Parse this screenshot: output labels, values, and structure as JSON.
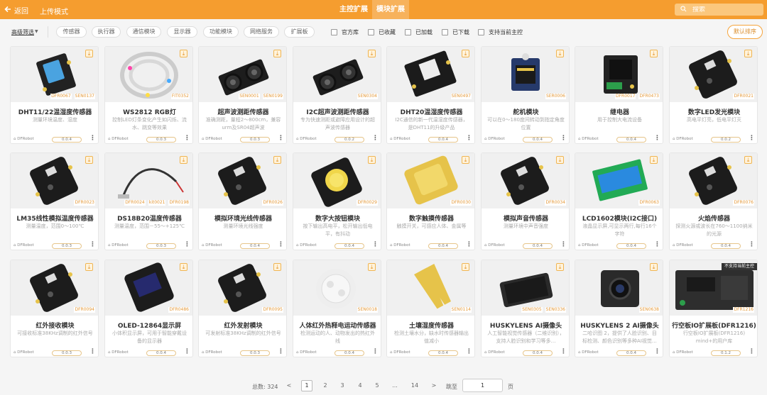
{
  "header": {
    "back_label": "返回",
    "mode_label": "上传模式",
    "tabs": [
      {
        "label": "主控扩展"
      },
      {
        "label": "模块扩展"
      }
    ],
    "search_placeholder": "搜索",
    "colors": {
      "accent": "#f59d2f"
    }
  },
  "filters": {
    "advanced_label": "高级筛选",
    "chips": [
      "传感器",
      "执行器",
      "通信模块",
      "显示器",
      "功能模块",
      "网络服务",
      "扩展板"
    ],
    "checks": [
      "官方库",
      "已收藏",
      "已加载",
      "已下载",
      "支持当前主控"
    ],
    "sort_label": "默认排序"
  },
  "cards": [
    {
      "title": "DHT11/22温湿度传感器",
      "desc": "测量环境温度、湿度",
      "codes": [
        "DFR0067",
        "SEN0137"
      ],
      "brand": "DFRobot",
      "ver": "0.0.4",
      "img": "blue-sensor"
    },
    {
      "title": "WS2812 RGB灯",
      "desc": "控制LED灯条变化产生如闪烁、流水、跳变等效果",
      "codes": [
        "FIT0352"
      ],
      "brand": "DFRobot",
      "ver": "0.0.3",
      "img": "led-strip"
    },
    {
      "title": "超声波测距传感器",
      "desc": "准确测距，量程2～800cm，兼容urm及SR04超声波",
      "codes": [
        "SEN0001",
        "SEN0199"
      ],
      "brand": "DFRobot",
      "ver": "0.0.3",
      "img": "ultrasonic"
    },
    {
      "title": "I2C超声波测距传感器",
      "desc": "专为快速测距或避障应用设计的超声波传感器",
      "codes": [
        "SEN0304"
      ],
      "brand": "DFRobot",
      "ver": "0.0.2",
      "img": "ultrasonic"
    },
    {
      "title": "DHT20温湿度传感器",
      "desc": "I2C通信的新一代温湿度传感器，是DHT11的升级产品",
      "codes": [
        "SEN0497"
      ],
      "brand": "DFRobot",
      "ver": "0.0.4",
      "img": "dht20"
    },
    {
      "title": "舵机模块",
      "desc": "可以在0～180度间转动到指定角度位置",
      "codes": [
        "SER0006"
      ],
      "brand": "DFRobot",
      "ver": "0.0.4",
      "img": "servo"
    },
    {
      "title": "继电器",
      "desc": "用于控制大电流设备",
      "codes": [
        "DFR0017",
        "DFR0473"
      ],
      "brand": "DFRobot",
      "ver": "0.0.4",
      "img": "relay"
    },
    {
      "title": "数字LED发光模块",
      "desc": "高电平灯亮，低电平灯灭",
      "codes": [
        "DFR0021"
      ],
      "brand": "DFRobot",
      "ver": "0.0.2",
      "img": "dark-board"
    },
    {
      "title": "LM35线性模拟温度传感器",
      "desc": "测量温度，范围0～100℃",
      "codes": [
        "DFR0023"
      ],
      "brand": "DFRobot",
      "ver": "0.0.3",
      "img": "dark-board"
    },
    {
      "title": "DS18B20温度传感器",
      "desc": "测量温度，范围－55～+125℃",
      "codes": [
        "DFR0024",
        "kit0021",
        "DFR0198"
      ],
      "brand": "DFRobot",
      "ver": "0.0.3",
      "img": "probe"
    },
    {
      "title": "模拟环境光线传感器",
      "desc": "测量环境光线强度",
      "codes": [
        "DFR0026"
      ],
      "brand": "DFRobot",
      "ver": "0.0.4",
      "img": "dark-board"
    },
    {
      "title": "数字大按钮模块",
      "desc": "按下输出高电平，松开输出低电平，有抖动",
      "codes": [
        "DFR0029"
      ],
      "brand": "DFRobot",
      "ver": "0.0.4",
      "img": "button"
    },
    {
      "title": "数字触摸传感器",
      "desc": "触摸开关，可感应人体、金属等",
      "codes": [
        "DFR0030"
      ],
      "brand": "DFRobot",
      "ver": "0.0.4",
      "img": "touch"
    },
    {
      "title": "模拟声音传感器",
      "desc": "测量环境中声音强度",
      "codes": [
        "DFR0034"
      ],
      "brand": "DFRobot",
      "ver": "0.0.4",
      "img": "dark-board"
    },
    {
      "title": "LCD1602模块(I2C接口)",
      "desc": "液晶显示屏,可显示两行,每行16个字符",
      "codes": [
        "DFR0063"
      ],
      "brand": "DFRobot",
      "ver": "0.0.4",
      "img": "lcd"
    },
    {
      "title": "火焰传感器",
      "desc": "探测火源或波长在760～1100纳米的光源",
      "codes": [
        "DFR0076"
      ],
      "brand": "DFRobot",
      "ver": "0.0.4",
      "img": "dark-board"
    },
    {
      "title": "红外接收模块",
      "desc": "可接收标准38KHz调制的红外信号",
      "codes": [
        "DFR0094"
      ],
      "brand": "DFRobot",
      "ver": "0.0.3",
      "img": "dark-board"
    },
    {
      "title": "OLED-12864显示屏",
      "desc": "小体积显示屏，可用于智能穿戴设备的显示器",
      "codes": [
        "DFR0486"
      ],
      "brand": "DFRobot",
      "ver": "0.0.4",
      "img": "oled"
    },
    {
      "title": "红外发射模块",
      "desc": "可发射标准38KHz调制的红外信号",
      "codes": [
        "DFR0095"
      ],
      "brand": "DFRobot",
      "ver": "0.0.3",
      "img": "dark-board"
    },
    {
      "title": "人体红外热释电运动传感器",
      "desc": "检测运动的人、动物发出的热红外线",
      "codes": [
        "SEN0018"
      ],
      "brand": "DFRobot",
      "ver": "0.0.4",
      "img": "pir"
    },
    {
      "title": "土壤湿度传感器",
      "desc": "检测土壤水分，缺水时传感器输出值减小",
      "codes": [
        "SEN0114"
      ],
      "brand": "DFRobot",
      "ver": "0.0.4",
      "img": "soil"
    },
    {
      "title": "HUSKYLENS AI摄像头",
      "desc": "人工智能视觉传感器（二维识别），支持人脸识别和学习等多…",
      "codes": [
        "SEN0305",
        "SEN0336"
      ],
      "brand": "DFRobot",
      "ver": "0.0.4",
      "img": "husky"
    },
    {
      "title": "HUSKYLENS 2 AI摄像头",
      "desc": "二哈识图 2，提供了人脸识别、目标检测、颜色识别等多种AI视觉…",
      "codes": [
        "SEN0638"
      ],
      "brand": "DFRobot",
      "ver": "0.0.4",
      "img": "husky2"
    },
    {
      "title": "行空板IO扩展板(DFR1216)",
      "desc": "行空板IO扩展板(DFR1216) mind+的用户库",
      "codes": [
        "DFR1216"
      ],
      "brand": "DFRobot",
      "ver": "0.1.2",
      "img": "io-board",
      "badge": "不支持当前主控"
    }
  ],
  "pager": {
    "total_label": "总数: 324",
    "prev": "<",
    "pages": [
      "1",
      "2",
      "3",
      "4",
      "5",
      "...",
      "14"
    ],
    "next": ">",
    "jump_label": "跳至",
    "jump_value": "1",
    "unit_label": "页"
  }
}
